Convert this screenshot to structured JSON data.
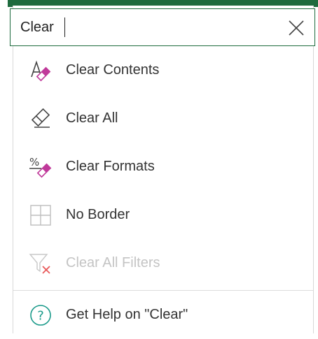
{
  "search": {
    "value": "Clear",
    "placeholder": ""
  },
  "colors": {
    "accent": "#1e6b3e",
    "eraser": "#c0399a",
    "help": "#1a9a8a",
    "error": "#e8595a"
  },
  "menu": {
    "items": [
      {
        "label": "Clear Contents",
        "icon": "clear-contents-icon",
        "enabled": true
      },
      {
        "label": "Clear All",
        "icon": "eraser-icon",
        "enabled": true
      },
      {
        "label": "Clear Formats",
        "icon": "clear-formats-icon",
        "enabled": true
      },
      {
        "label": "No Border",
        "icon": "no-border-icon",
        "enabled": true
      },
      {
        "label": "Clear All Filters",
        "icon": "clear-filter-icon",
        "enabled": false
      }
    ],
    "help": {
      "label": "Get Help on \"Clear\"",
      "icon": "help-icon"
    }
  }
}
